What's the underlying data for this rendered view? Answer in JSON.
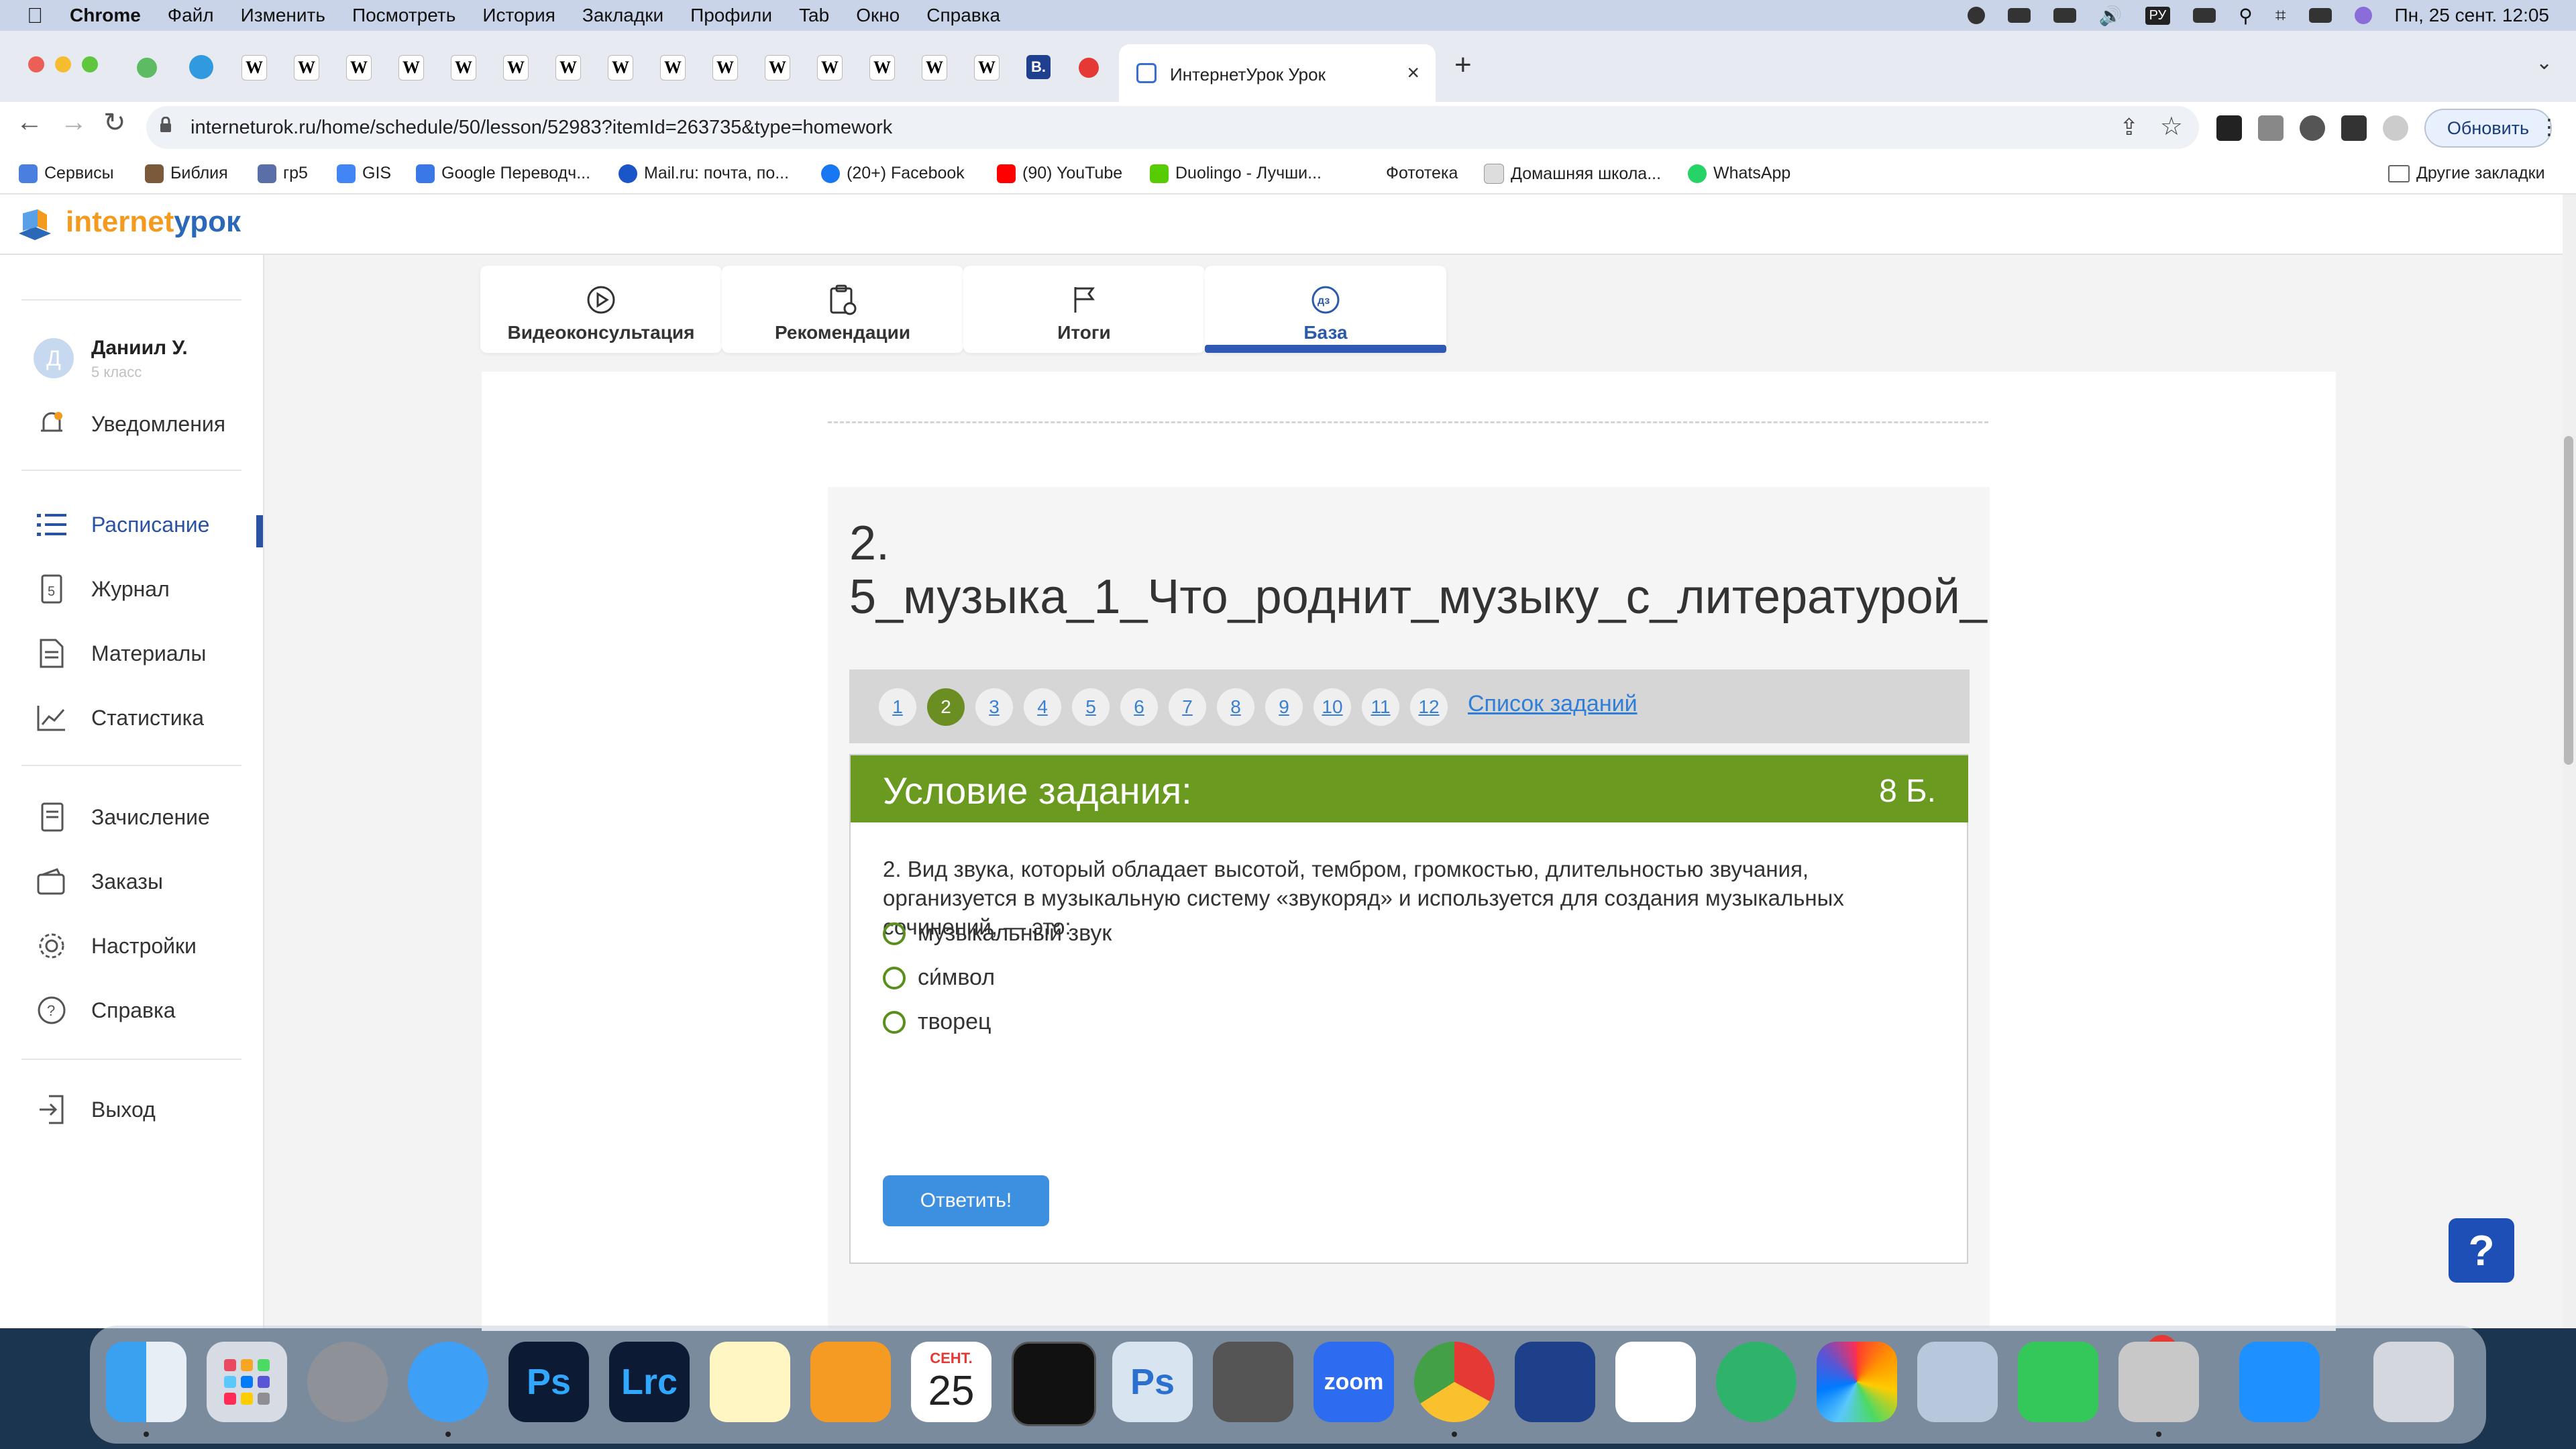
{
  "menubar": {
    "app": "Chrome",
    "items": [
      "Файл",
      "Изменить",
      "Посмотреть",
      "История",
      "Закладки",
      "Профили",
      "Tab",
      "Окно",
      "Справка"
    ],
    "input_lang": "РУ",
    "datetime": "Пн, 25 сент.  12:05"
  },
  "tabs": {
    "pinned_letter": "W",
    "b_letter": "B.",
    "active_title": "ИнтернетУрок Урок",
    "close": "×",
    "new_tab": "+"
  },
  "toolbar": {
    "url": "interneturok.ru/home/schedule/50/lesson/52983?itemId=263735&type=homework",
    "update_label": "Обновить"
  },
  "bookmarks": {
    "items": [
      "Сервисы",
      "Библия",
      "гр5",
      "GIS",
      "Google Переводч...",
      "Mail.ru: почта, по...",
      "(20+) Facebook",
      "(90) YouTube",
      "Duolingo - Лучши...",
      "Фототека",
      "Домашняя школа...",
      "WhatsApp"
    ],
    "other": "Другие закладки"
  },
  "site": {
    "logo_part1": "internet",
    "logo_part2": "урок"
  },
  "user": {
    "initial": "Д",
    "name": "Даниил У.",
    "grade": "5 класс"
  },
  "sidebar": {
    "notifications": "Уведомления",
    "items": [
      "Расписание",
      "Журнал",
      "Материалы",
      "Статистика"
    ],
    "items2": [
      "Зачисление",
      "Заказы",
      "Настройки",
      "Справка"
    ],
    "logout": "Выход"
  },
  "page_tabs": [
    {
      "label": "Видеоконсультация",
      "icon": "play-circle-icon"
    },
    {
      "label": "Рекомендации",
      "icon": "clipboard-icon"
    },
    {
      "label": "Итоги",
      "icon": "flag-icon"
    },
    {
      "label": "База",
      "icon": "homework-dz-icon",
      "icon_text": "дз",
      "active": true
    }
  ],
  "lesson": {
    "title_line1": "2.",
    "title_line2": "5_музыка_1_Что_роднит_музыку_с_литературой_"
  },
  "pager": {
    "pages": [
      "1",
      "2",
      "3",
      "4",
      "5",
      "6",
      "7",
      "8",
      "9",
      "10",
      "11",
      "12"
    ],
    "current": "2",
    "task_list": "Список заданий"
  },
  "task": {
    "header": "Условие задания:",
    "points": "8 Б.",
    "question": "2. Вид звука, который обладает высотой, тембром, громкостью, длительностью звучания, организуется в музыкальную систему «звукоряд» и используется для создания музыкальных сочинений, — это:",
    "options": [
      "музыкальный звук",
      "си́мвол",
      "творец"
    ],
    "submit": "Ответить!"
  },
  "help": "?",
  "dock": {
    "ps": "Ps",
    "lrc": "Lrc",
    "cal_month": "СЕНТ.",
    "cal_day": "25",
    "zoom": "zoom",
    "facetime_badge": "1"
  },
  "colors": {
    "task_header": "#6b9a20",
    "accent_blue": "#2f59b4",
    "button_blue": "#3d8fe0",
    "logo_orange": "#f39a1f"
  }
}
